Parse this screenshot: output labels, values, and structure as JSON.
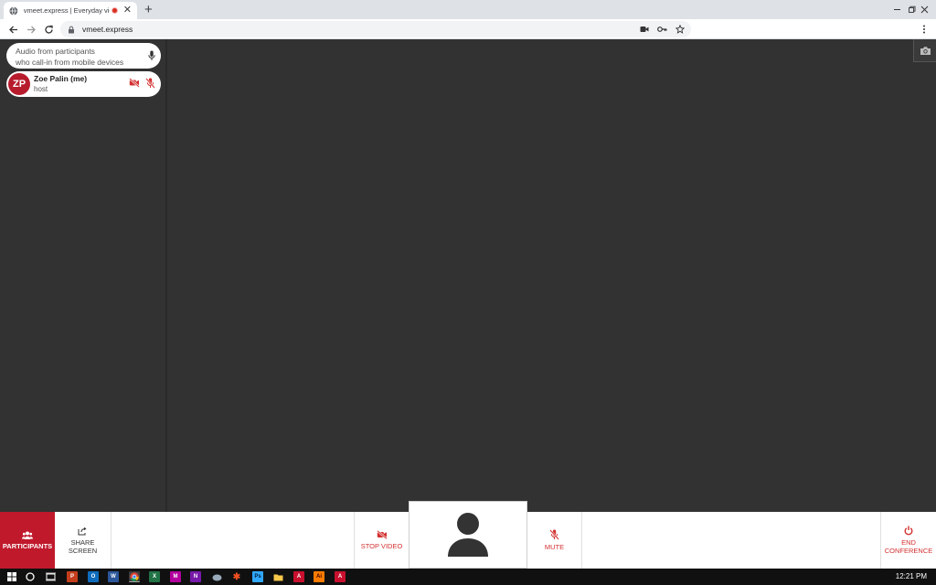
{
  "browser": {
    "tab_title": "vmeet.express | Everyday vid",
    "url": "vmeet.express",
    "new_tab_label": "+",
    "close_tab_label": "✕"
  },
  "sidebar": {
    "audio_line1": "Audio from participants",
    "audio_line2": "who call-in from mobile devices",
    "participants": [
      {
        "initials": "ZP",
        "name": "Zoe Palin (me)",
        "role": "host"
      }
    ]
  },
  "controls": {
    "participants_label": "PARTICIPANTS",
    "share_line1": "SHARE",
    "share_line2": "SCREEN",
    "stop_video_label": "STOP VIDEO",
    "mute_label": "MUTE",
    "end_line1": "END",
    "end_line2": "CONFERENCE"
  },
  "taskbar": {
    "clock": "12:21 PM"
  },
  "colors": {
    "accent_red": "#c0192c",
    "control_red": "#d32f2f",
    "stage_bg": "#323232"
  }
}
